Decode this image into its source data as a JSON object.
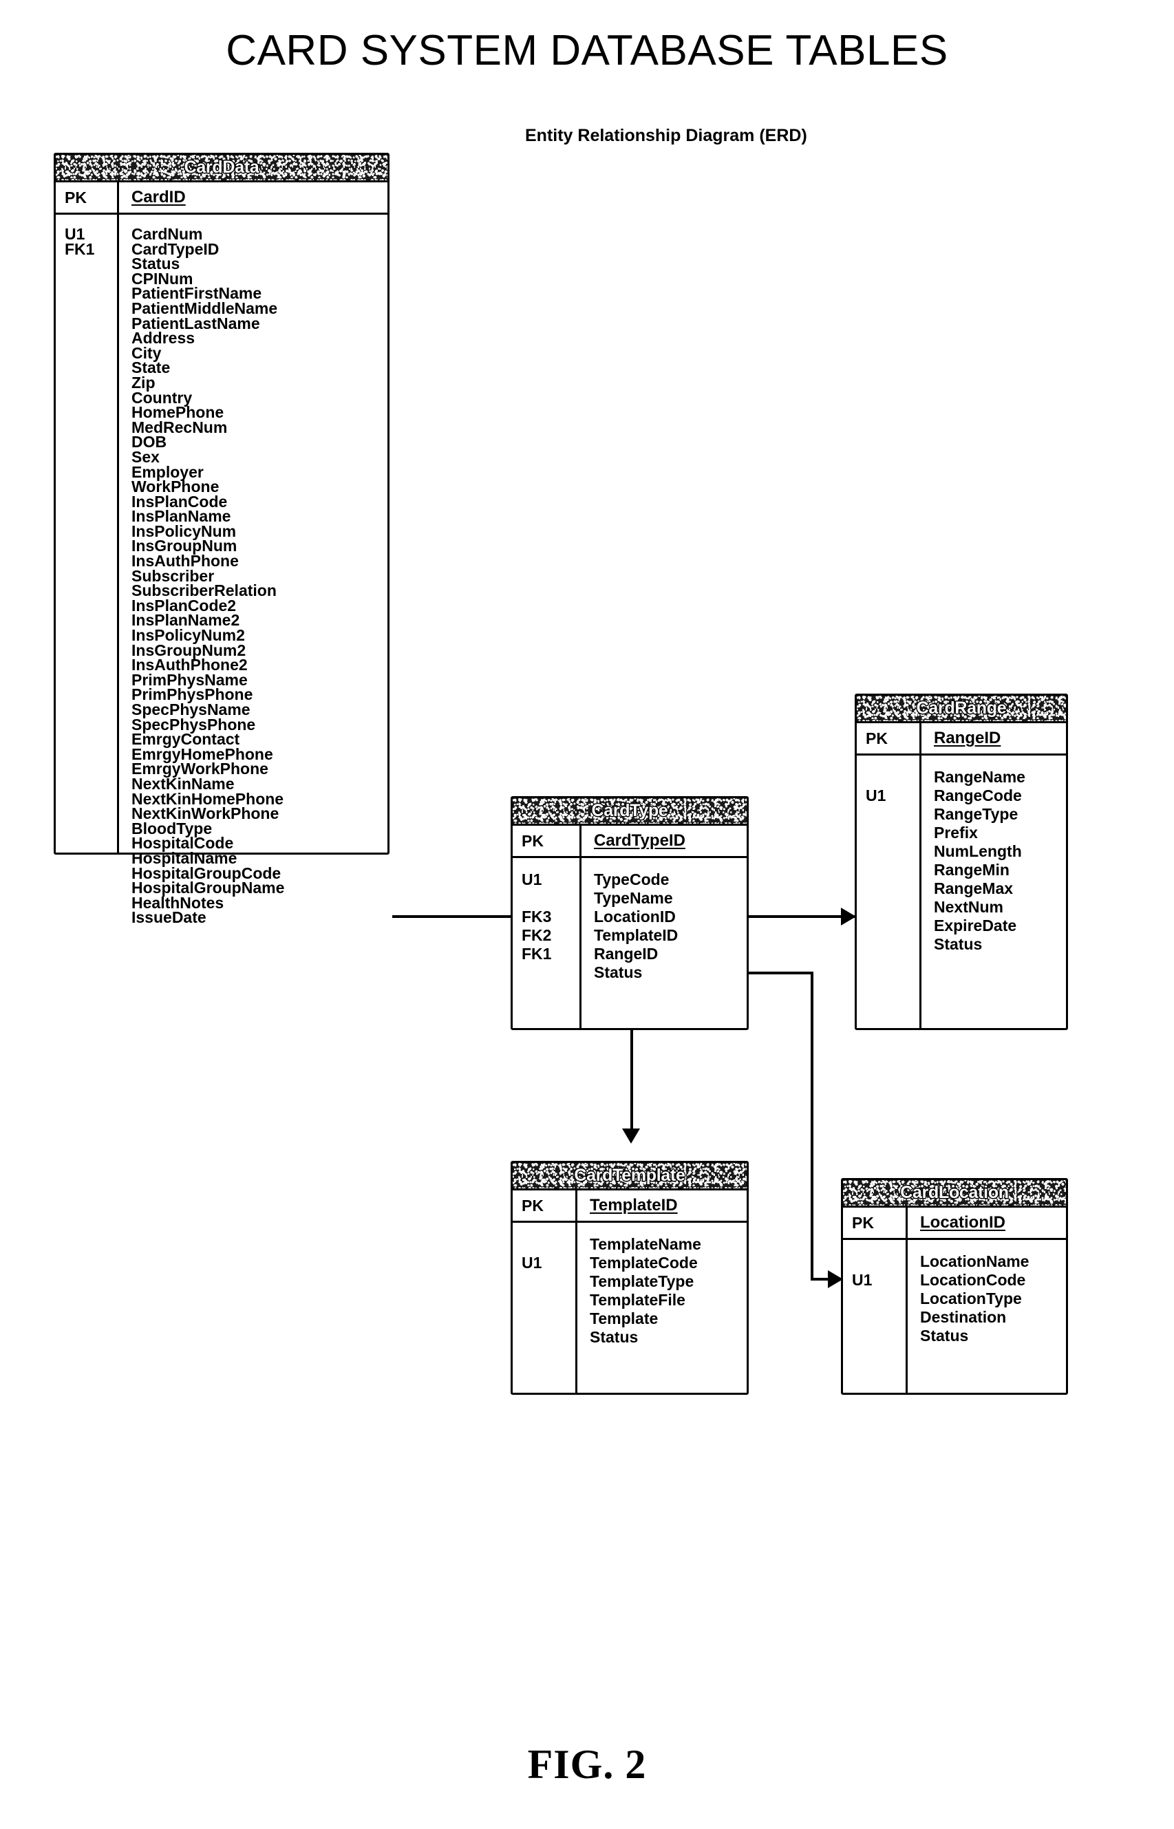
{
  "page": {
    "title": "CARD SYSTEM DATABASE TABLES",
    "subtitle": "Entity Relationship Diagram (ERD)",
    "figure_caption": "FIG. 2"
  },
  "colors": {
    "line": "#000000",
    "background": "#ffffff",
    "header_fill": "#1a1a1a",
    "header_text": "#ffffff"
  },
  "entities": {
    "card_data": {
      "name": "CardData",
      "pk_flag": "PK",
      "pk_field": "CardID",
      "flags": [
        "U1",
        "FK1"
      ],
      "attributes": [
        "CardNum",
        "CardTypeID",
        "Status",
        "CPINum",
        "PatientFirstName",
        "PatientMiddleName",
        "PatientLastName",
        "Address",
        "City",
        "State",
        "Zip",
        "Country",
        "HomePhone",
        "MedRecNum",
        "DOB",
        "Sex",
        "Employer",
        "WorkPhone",
        "InsPlanCode",
        "InsPlanName",
        "InsPolicyNum",
        "InsGroupNum",
        "InsAuthPhone",
        "Subscriber",
        "SubscriberRelation",
        "InsPlanCode2",
        "InsPlanName2",
        "InsPolicyNum2",
        "InsGroupNum2",
        "InsAuthPhone2",
        "PrimPhysName",
        "PrimPhysPhone",
        "SpecPhysName",
        "SpecPhysPhone",
        "EmrgyContact",
        "EmrgyHomePhone",
        "EmrgyWorkPhone",
        "NextKinName",
        "NextKinHomePhone",
        "NextKinWorkPhone",
        "BloodType",
        "HospitalCode",
        "HospitalName",
        "HospitalGroupCode",
        "HospitalGroupName",
        "HealthNotes",
        "IssueDate"
      ]
    },
    "card_type": {
      "name": "CardType",
      "pk_flag": "PK",
      "pk_field": "CardTypeID",
      "flags": [
        "U1",
        "",
        "FK3",
        "FK2",
        "FK1",
        ""
      ],
      "attributes": [
        "TypeCode",
        "TypeName",
        "LocationID",
        "TemplateID",
        "RangeID",
        "Status"
      ]
    },
    "card_range": {
      "name": "CardRange",
      "pk_flag": "PK",
      "pk_field": "RangeID",
      "flags": [
        "",
        "U1",
        "",
        "",
        "",
        "",
        "",
        "",
        "",
        ""
      ],
      "attributes": [
        "RangeName",
        "RangeCode",
        "RangeType",
        "Prefix",
        "NumLength",
        "RangeMin",
        "RangeMax",
        "NextNum",
        "ExpireDate",
        "Status"
      ]
    },
    "card_template": {
      "name": "CardTemplate",
      "pk_flag": "PK",
      "pk_field": "TemplateID",
      "flags": [
        "",
        "U1",
        "",
        "",
        "",
        ""
      ],
      "attributes": [
        "TemplateName",
        "TemplateCode",
        "TemplateType",
        "TemplateFile",
        "Template",
        "Status"
      ]
    },
    "card_location": {
      "name": "CardLocation",
      "pk_flag": "PK",
      "pk_field": "LocationID",
      "flags": [
        "",
        "U1",
        "",
        "",
        ""
      ],
      "attributes": [
        "LocationName",
        "LocationCode",
        "LocationType",
        "Destination",
        "Status"
      ]
    }
  },
  "relationships": [
    {
      "from": "CardData",
      "to": "CardType",
      "label": ""
    },
    {
      "from": "CardType",
      "to": "CardRange",
      "label": ""
    },
    {
      "from": "CardType",
      "to": "CardTemplate",
      "label": ""
    },
    {
      "from": "CardType",
      "to": "CardLocation",
      "label": ""
    }
  ]
}
